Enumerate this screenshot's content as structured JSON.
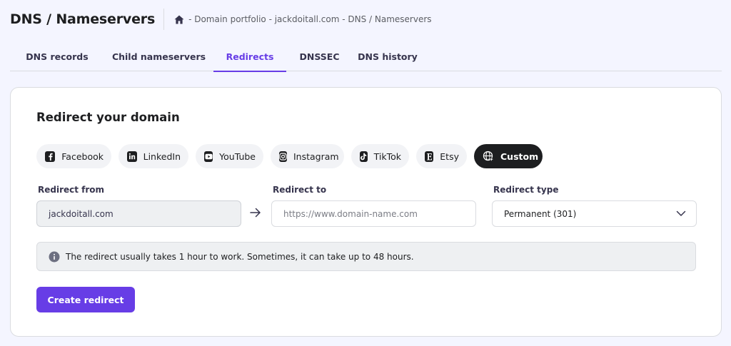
{
  "header": {
    "title": "DNS / Nameservers",
    "breadcrumb": "- Domain portfolio - jackdoitall.com - DNS / Nameservers"
  },
  "tabs": [
    {
      "label": "DNS records",
      "active": false
    },
    {
      "label": "Child nameservers",
      "active": false
    },
    {
      "label": "Redirects",
      "active": true
    },
    {
      "label": "DNSSEC",
      "active": false
    },
    {
      "label": "DNS history",
      "active": false
    }
  ],
  "card": {
    "title": "Redirect your domain",
    "presets": [
      {
        "label": "Facebook",
        "icon": "facebook-icon"
      },
      {
        "label": "LinkedIn",
        "icon": "linkedin-icon"
      },
      {
        "label": "YouTube",
        "icon": "youtube-icon"
      },
      {
        "label": "Instagram",
        "icon": "instagram-icon"
      },
      {
        "label": "TikTok",
        "icon": "tiktok-icon"
      },
      {
        "label": "Etsy",
        "icon": "etsy-icon"
      },
      {
        "label": "Custom",
        "icon": "globe-cursor-icon",
        "selected": true
      }
    ],
    "redirect_from": {
      "label": "Redirect from",
      "value": "jackdoitall.com"
    },
    "redirect_to": {
      "label": "Redirect to",
      "value": "",
      "placeholder": "https://www.domain-name.com"
    },
    "redirect_type": {
      "label": "Redirect type",
      "value": "Permanent (301)"
    },
    "notice": "The redirect usually takes 1 hour to work. Sometimes, it can take up to 48 hours.",
    "create_button": "Create redirect"
  },
  "colors": {
    "accent": "#673de6",
    "text_dark": "#1d1e20",
    "chip_bg": "#f2f3f6",
    "page_bg": "#f4f5ff"
  }
}
